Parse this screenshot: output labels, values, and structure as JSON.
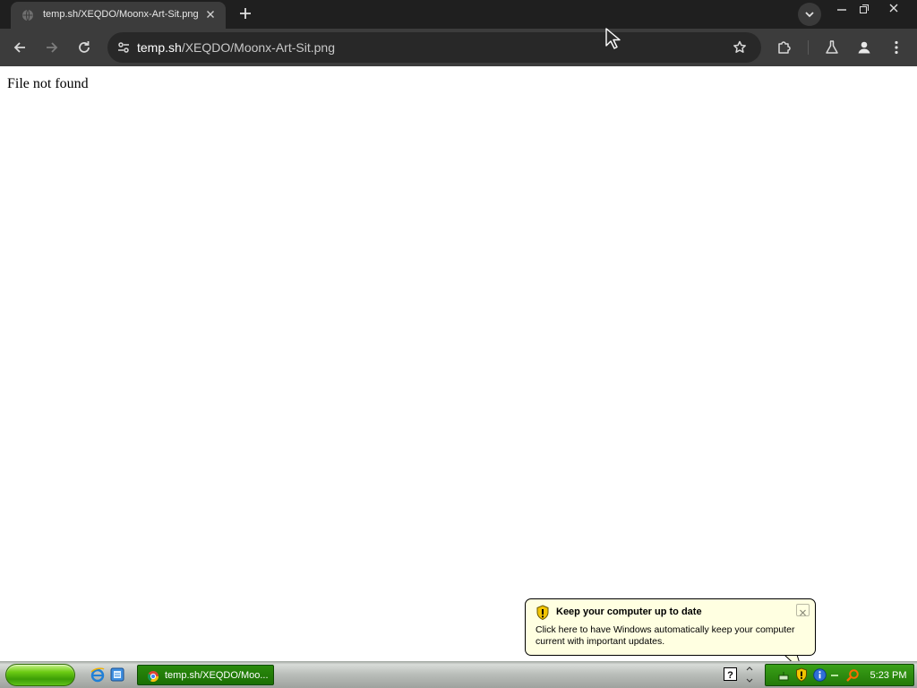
{
  "browser": {
    "tab": {
      "title": "temp.sh/XEQDO/Moonx-Art-Sit.png",
      "favicon": "globe-icon"
    },
    "address_bar": {
      "host": "temp.sh",
      "path": "/XEQDO/Moonx-Art-Sit.png"
    },
    "icons": {
      "back": "arrow-left-icon",
      "forward": "arrow-right-icon",
      "reload": "reload-icon",
      "site_info": "tune-icon",
      "bookmark": "star-icon",
      "extensions": "puzzle-icon",
      "labs": "flask-icon",
      "profile": "person-icon",
      "menu": "kebab-icon"
    }
  },
  "page": {
    "message": "File not found"
  },
  "balloon": {
    "title": "Keep your computer up to date",
    "body": "Click here to have Windows automatically keep your computer current with important updates."
  },
  "taskbar": {
    "active_task_label": "temp.sh/XEQDO/Moo...",
    "clock": "5:23 PM",
    "colors": {
      "start_green": "#3c9e06",
      "tray_green": "#237a08",
      "balloon_bg": "#ffffe1"
    }
  }
}
